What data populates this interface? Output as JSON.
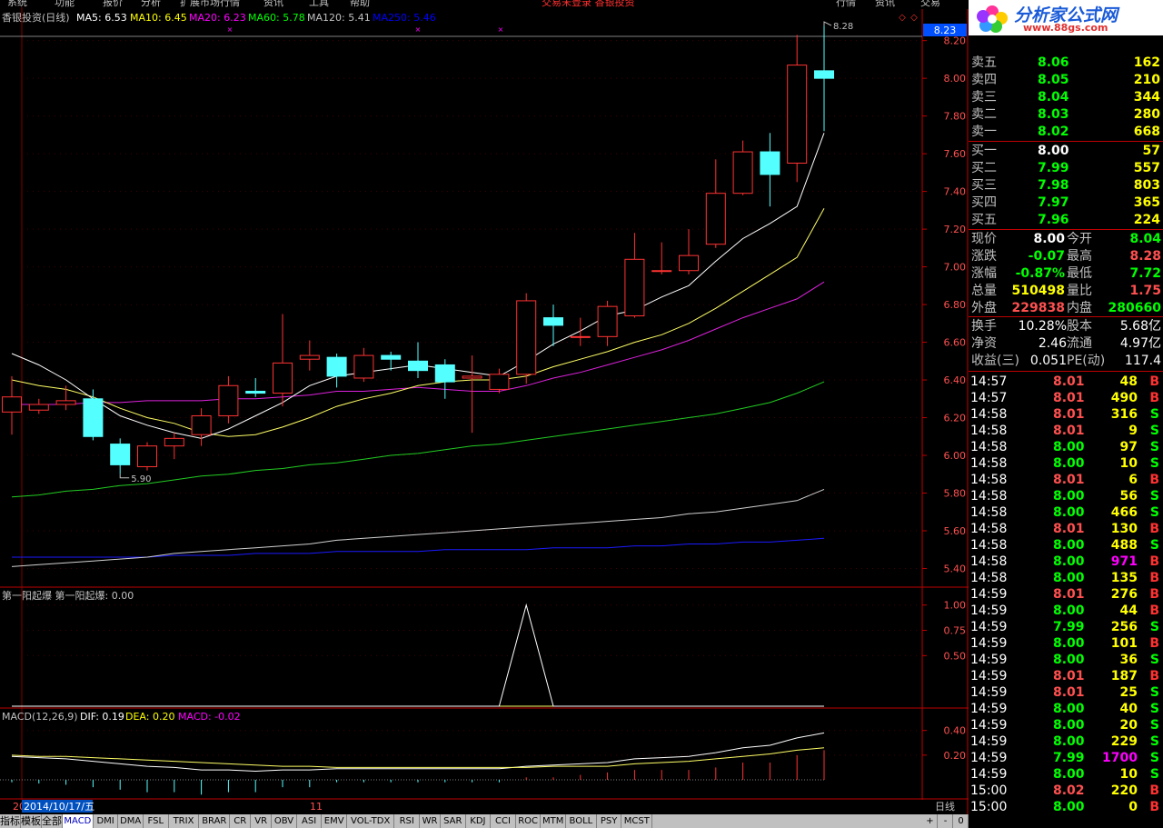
{
  "menu": [
    "系统",
    "功能",
    "报价",
    "分析",
    "扩展市场行情",
    "资讯",
    "工具",
    "帮助"
  ],
  "menu_right": {
    "center": "交易未登录 香银投资",
    "tabs": [
      "行情",
      "资讯",
      "交易"
    ]
  },
  "header": {
    "title": "香银投资(日线)",
    "ma": [
      {
        "label": "MA5: 6.53",
        "color": "#ffffff"
      },
      {
        "label": "MA10: 6.45",
        "color": "#ffff00"
      },
      {
        "label": "MA20: 6.23",
        "color": "#ff00ff"
      },
      {
        "label": "MA60: 5.78",
        "color": "#00ff00"
      },
      {
        "label": "MA120: 5.41",
        "color": "#c0c0c0"
      },
      {
        "label": "MA250: 5.46",
        "color": "#0000ff"
      }
    ]
  },
  "price_axis": {
    "ticks": [
      "8.20",
      "8.00",
      "7.80",
      "7.60",
      "7.40",
      "7.20",
      "7.00",
      "6.80",
      "6.60",
      "6.40",
      "6.20",
      "6.00",
      "5.80",
      "5.60",
      "5.40"
    ],
    "current": "8.23",
    "high_label": "8.28",
    "low_label": "5.90"
  },
  "indicator1": {
    "title": "第一阳起爆 第一阳起爆: 0.00",
    "ticks": [
      "1.00",
      "0.75",
      "0.50"
    ]
  },
  "macd": {
    "title_parts": [
      {
        "text": "MACD(12,26,9)",
        "color": "#c0c0c0"
      },
      {
        "text": "DIF: 0.19",
        "color": "#ffffff"
      },
      {
        "text": "DEA: 0.20",
        "color": "#ffff00"
      },
      {
        "text": "MACD: -0.02",
        "color": "#ff00ff"
      }
    ],
    "ticks": [
      "0.40",
      "0.20"
    ]
  },
  "date_axis": {
    "left_label": "20",
    "cursor_date": "2014/10/17/五",
    "month_label": "11",
    "period": "日线"
  },
  "bottom_tabs": [
    "指标",
    "模板",
    "全部",
    "MACD",
    "DMI",
    "DMA",
    "FSL",
    "TRIX",
    "BRAR",
    "CR",
    "VR",
    "OBV",
    "ASI",
    "EMV",
    "VOL-TDX",
    "RSI",
    "WR",
    "SAR",
    "KDJ",
    "CCI",
    "ROC",
    "MTM",
    "BOLL",
    "PSY",
    "MCST"
  ],
  "bottom_right": [
    "+",
    "-",
    "0"
  ],
  "logo": {
    "text": "分析家公式网",
    "url": "www.88gs.com"
  },
  "order_book": {
    "sell": [
      {
        "label": "卖五",
        "price": "8.06",
        "vol": "162"
      },
      {
        "label": "卖四",
        "price": "8.05",
        "vol": "210"
      },
      {
        "label": "卖三",
        "price": "8.04",
        "vol": "344"
      },
      {
        "label": "卖二",
        "price": "8.03",
        "vol": "280"
      },
      {
        "label": "卖一",
        "price": "8.02",
        "vol": "668"
      }
    ],
    "buy": [
      {
        "label": "买一",
        "price": "8.00",
        "vol": "57"
      },
      {
        "label": "买二",
        "price": "7.99",
        "vol": "557"
      },
      {
        "label": "买三",
        "price": "7.98",
        "vol": "803"
      },
      {
        "label": "买四",
        "price": "7.97",
        "vol": "365"
      },
      {
        "label": "买五",
        "price": "7.96",
        "vol": "224"
      }
    ]
  },
  "stats": [
    {
      "l1": "现价",
      "v1": "8.00",
      "c1": "#ffffff",
      "l2": "今开",
      "v2": "8.04",
      "c2": "#00ff00"
    },
    {
      "l1": "涨跌",
      "v1": "-0.07",
      "c1": "#00ff00",
      "l2": "最高",
      "v2": "8.28",
      "c2": "#ff5050"
    },
    {
      "l1": "涨幅",
      "v1": "-0.87%",
      "c1": "#00ff00",
      "l2": "最低",
      "v2": "7.72",
      "c2": "#00ff00"
    },
    {
      "l1": "总量",
      "v1": "510498",
      "c1": "#ffff00",
      "l2": "量比",
      "v2": "1.75",
      "c2": "#ff5050"
    },
    {
      "l1": "外盘",
      "v1": "229838",
      "c1": "#ff5050",
      "l2": "内盘",
      "v2": "280660",
      "c2": "#00ff00"
    }
  ],
  "stats2": [
    {
      "l1": "换手",
      "v1": "10.28%",
      "l2": "股本",
      "v2": "5.68亿"
    },
    {
      "l1": "净资",
      "v1": "2.46",
      "l2": "流通",
      "v2": "4.97亿"
    },
    {
      "l1": "收益(三)",
      "v1": "0.051",
      "l2": "PE(动)",
      "v2": "117.4"
    }
  ],
  "ticks": [
    {
      "time": "14:57",
      "price": "8.01",
      "vol": "48",
      "bs": "B",
      "pc": "#ff5050",
      "vc": "#ffff00"
    },
    {
      "time": "14:57",
      "price": "8.01",
      "vol": "490",
      "bs": "B",
      "pc": "#ff5050",
      "vc": "#ffff00"
    },
    {
      "time": "14:58",
      "price": "8.01",
      "vol": "316",
      "bs": "S",
      "pc": "#ff5050",
      "vc": "#ffff00"
    },
    {
      "time": "14:58",
      "price": "8.01",
      "vol": "9",
      "bs": "S",
      "pc": "#ff5050",
      "vc": "#ffff00"
    },
    {
      "time": "14:58",
      "price": "8.00",
      "vol": "97",
      "bs": "S",
      "pc": "#00ff00",
      "vc": "#ffff00"
    },
    {
      "time": "14:58",
      "price": "8.00",
      "vol": "10",
      "bs": "S",
      "pc": "#00ff00",
      "vc": "#ffff00"
    },
    {
      "time": "14:58",
      "price": "8.01",
      "vol": "6",
      "bs": "B",
      "pc": "#ff5050",
      "vc": "#ffff00"
    },
    {
      "time": "14:58",
      "price": "8.00",
      "vol": "56",
      "bs": "S",
      "pc": "#00ff00",
      "vc": "#ffff00"
    },
    {
      "time": "14:58",
      "price": "8.00",
      "vol": "466",
      "bs": "S",
      "pc": "#00ff00",
      "vc": "#ffff00"
    },
    {
      "time": "14:58",
      "price": "8.01",
      "vol": "130",
      "bs": "B",
      "pc": "#ff5050",
      "vc": "#ffff00"
    },
    {
      "time": "14:58",
      "price": "8.00",
      "vol": "488",
      "bs": "S",
      "pc": "#00ff00",
      "vc": "#ffff00"
    },
    {
      "time": "14:58",
      "price": "8.00",
      "vol": "971",
      "bs": "B",
      "pc": "#00ff00",
      "vc": "#ff00ff"
    },
    {
      "time": "14:58",
      "price": "8.00",
      "vol": "135",
      "bs": "B",
      "pc": "#00ff00",
      "vc": "#ffff00"
    },
    {
      "time": "14:59",
      "price": "8.01",
      "vol": "276",
      "bs": "B",
      "pc": "#ff5050",
      "vc": "#ffff00"
    },
    {
      "time": "14:59",
      "price": "8.00",
      "vol": "44",
      "bs": "B",
      "pc": "#00ff00",
      "vc": "#ffff00"
    },
    {
      "time": "14:59",
      "price": "7.99",
      "vol": "256",
      "bs": "S",
      "pc": "#00ff00",
      "vc": "#ffff00"
    },
    {
      "time": "14:59",
      "price": "8.00",
      "vol": "101",
      "bs": "B",
      "pc": "#00ff00",
      "vc": "#ffff00"
    },
    {
      "time": "14:59",
      "price": "8.00",
      "vol": "36",
      "bs": "S",
      "pc": "#00ff00",
      "vc": "#ffff00"
    },
    {
      "time": "14:59",
      "price": "8.01",
      "vol": "187",
      "bs": "B",
      "pc": "#ff5050",
      "vc": "#ffff00"
    },
    {
      "time": "14:59",
      "price": "8.01",
      "vol": "25",
      "bs": "S",
      "pc": "#ff5050",
      "vc": "#ffff00"
    },
    {
      "time": "14:59",
      "price": "8.00",
      "vol": "40",
      "bs": "S",
      "pc": "#00ff00",
      "vc": "#ffff00"
    },
    {
      "time": "14:59",
      "price": "8.00",
      "vol": "20",
      "bs": "S",
      "pc": "#00ff00",
      "vc": "#ffff00"
    },
    {
      "time": "14:59",
      "price": "8.00",
      "vol": "229",
      "bs": "S",
      "pc": "#00ff00",
      "vc": "#ffff00"
    },
    {
      "time": "14:59",
      "price": "7.99",
      "vol": "1700",
      "bs": "S",
      "pc": "#00ff00",
      "vc": "#ff00ff"
    },
    {
      "time": "14:59",
      "price": "8.00",
      "vol": "10",
      "bs": "S",
      "pc": "#00ff00",
      "vc": "#ffff00"
    },
    {
      "time": "15:00",
      "price": "8.02",
      "vol": "220",
      "bs": "B",
      "pc": "#ff5050",
      "vc": "#ffff00"
    },
    {
      "time": "15:00",
      "price": "8.00",
      "vol": "0",
      "bs": "B",
      "pc": "#00ff00",
      "vc": "#ffff00"
    }
  ],
  "chart_data": {
    "type": "candlestick",
    "price_range": [
      5.33,
      8.29
    ],
    "candles": [
      [
        6.23,
        6.31,
        6.11,
        6.42
      ],
      [
        6.24,
        6.27,
        6.22,
        6.3
      ],
      [
        6.27,
        6.29,
        6.24,
        6.37
      ],
      [
        6.3,
        6.1,
        6.08,
        6.35
      ],
      [
        6.06,
        5.95,
        5.9,
        6.09
      ],
      [
        5.94,
        6.05,
        5.92,
        6.07
      ],
      [
        6.05,
        6.09,
        5.98,
        6.12
      ],
      [
        6.11,
        6.21,
        6.05,
        6.25
      ],
      [
        6.21,
        6.37,
        6.17,
        6.42
      ],
      [
        6.34,
        6.33,
        6.31,
        6.41
      ],
      [
        6.33,
        6.49,
        6.26,
        6.75
      ],
      [
        6.51,
        6.53,
        6.45,
        6.61
      ],
      [
        6.52,
        6.42,
        6.36,
        6.54
      ],
      [
        6.41,
        6.53,
        6.39,
        6.57
      ],
      [
        6.53,
        6.51,
        6.45,
        6.55
      ],
      [
        6.5,
        6.45,
        6.41,
        6.6
      ],
      [
        6.48,
        6.39,
        6.3,
        6.51
      ],
      [
        6.41,
        6.42,
        6.12,
        6.53
      ],
      [
        6.35,
        6.43,
        6.33,
        6.46
      ],
      [
        6.43,
        6.82,
        6.38,
        6.86
      ],
      [
        6.73,
        6.69,
        6.58,
        6.8
      ],
      [
        6.63,
        6.63,
        6.58,
        6.73
      ],
      [
        6.63,
        6.79,
        6.58,
        6.82
      ],
      [
        6.74,
        7.04,
        6.73,
        7.18
      ],
      [
        6.98,
        6.98,
        6.96,
        7.13
      ],
      [
        6.98,
        7.06,
        6.96,
        7.2
      ],
      [
        7.12,
        7.39,
        7.1,
        7.57
      ],
      [
        7.39,
        7.61,
        7.38,
        7.67
      ],
      [
        7.61,
        7.49,
        7.32,
        7.71
      ],
      [
        7.55,
        8.07,
        7.45,
        8.23
      ],
      [
        8.04,
        8.0,
        7.72,
        8.28
      ]
    ],
    "ma5": [
      6.54,
      6.48,
      6.4,
      6.3,
      6.21,
      6.16,
      6.12,
      6.09,
      6.14,
      6.21,
      6.28,
      6.37,
      6.42,
      6.44,
      6.46,
      6.48,
      6.46,
      6.44,
      6.42,
      6.5,
      6.59,
      6.66,
      6.74,
      6.77,
      6.84,
      6.9,
      7.03,
      7.15,
      7.23,
      7.32,
      7.71
    ],
    "ma10": [
      6.4,
      6.37,
      6.35,
      6.31,
      6.25,
      6.2,
      6.17,
      6.12,
      6.1,
      6.11,
      6.15,
      6.2,
      6.26,
      6.3,
      6.33,
      6.37,
      6.39,
      6.4,
      6.4,
      6.42,
      6.47,
      6.51,
      6.55,
      6.6,
      6.64,
      6.7,
      6.78,
      6.87,
      6.96,
      7.05,
      7.31
    ],
    "ma20": [
      6.27,
      6.27,
      6.27,
      6.28,
      6.28,
      6.29,
      6.29,
      6.29,
      6.3,
      6.3,
      6.31,
      6.32,
      6.34,
      6.34,
      6.35,
      6.36,
      6.35,
      6.34,
      6.34,
      6.37,
      6.41,
      6.44,
      6.48,
      6.52,
      6.56,
      6.61,
      6.67,
      6.73,
      6.78,
      6.83,
      6.92
    ],
    "ma60": [
      5.78,
      5.79,
      5.81,
      5.82,
      5.84,
      5.85,
      5.87,
      5.89,
      5.9,
      5.92,
      5.93,
      5.95,
      5.96,
      5.98,
      6.0,
      6.01,
      6.03,
      6.05,
      6.06,
      6.08,
      6.1,
      6.12,
      6.14,
      6.16,
      6.18,
      6.2,
      6.22,
      6.25,
      6.28,
      6.33,
      6.39
    ],
    "ma120": [
      5.41,
      5.42,
      5.43,
      5.44,
      5.45,
      5.46,
      5.48,
      5.49,
      5.5,
      5.51,
      5.52,
      5.53,
      5.55,
      5.56,
      5.57,
      5.58,
      5.59,
      5.6,
      5.61,
      5.62,
      5.63,
      5.64,
      5.65,
      5.66,
      5.67,
      5.69,
      5.7,
      5.72,
      5.74,
      5.76,
      5.82
    ],
    "ma250": [
      5.46,
      5.46,
      5.46,
      5.46,
      5.46,
      5.46,
      5.47,
      5.47,
      5.47,
      5.48,
      5.48,
      5.48,
      5.49,
      5.49,
      5.49,
      5.49,
      5.5,
      5.5,
      5.5,
      5.5,
      5.51,
      5.51,
      5.51,
      5.52,
      5.52,
      5.53,
      5.53,
      5.54,
      5.54,
      5.55,
      5.56
    ],
    "signal_range": [
      0,
      1.15
    ],
    "signal": [
      0,
      0,
      0,
      0,
      0,
      0,
      0,
      0,
      0,
      0,
      0,
      0,
      0,
      0,
      0,
      0,
      0,
      0,
      0,
      1,
      0,
      0,
      0,
      0,
      0,
      0,
      0,
      0,
      0,
      0,
      0
    ],
    "macd_range": [
      -0.14,
      0.56
    ],
    "dif": [
      0.19,
      0.18,
      0.17,
      0.15,
      0.13,
      0.11,
      0.1,
      0.08,
      0.08,
      0.07,
      0.08,
      0.08,
      0.09,
      0.09,
      0.09,
      0.09,
      0.09,
      0.09,
      0.09,
      0.11,
      0.12,
      0.13,
      0.14,
      0.17,
      0.18,
      0.19,
      0.22,
      0.26,
      0.28,
      0.34,
      0.38
    ],
    "dea": [
      0.2,
      0.19,
      0.19,
      0.18,
      0.17,
      0.16,
      0.15,
      0.14,
      0.13,
      0.12,
      0.11,
      0.11,
      0.1,
      0.1,
      0.1,
      0.1,
      0.1,
      0.1,
      0.1,
      0.1,
      0.11,
      0.11,
      0.11,
      0.13,
      0.14,
      0.15,
      0.17,
      0.19,
      0.21,
      0.24,
      0.26
    ],
    "macd_hist": [
      -0.02,
      -0.03,
      -0.04,
      -0.06,
      -0.08,
      -0.1,
      -0.1,
      -0.12,
      -0.1,
      -0.1,
      -0.06,
      -0.06,
      -0.02,
      -0.02,
      -0.02,
      -0.02,
      -0.02,
      -0.02,
      -0.02,
      0.02,
      0.02,
      0.04,
      0.06,
      0.08,
      0.08,
      0.08,
      0.1,
      0.14,
      0.14,
      0.2,
      0.24
    ]
  }
}
